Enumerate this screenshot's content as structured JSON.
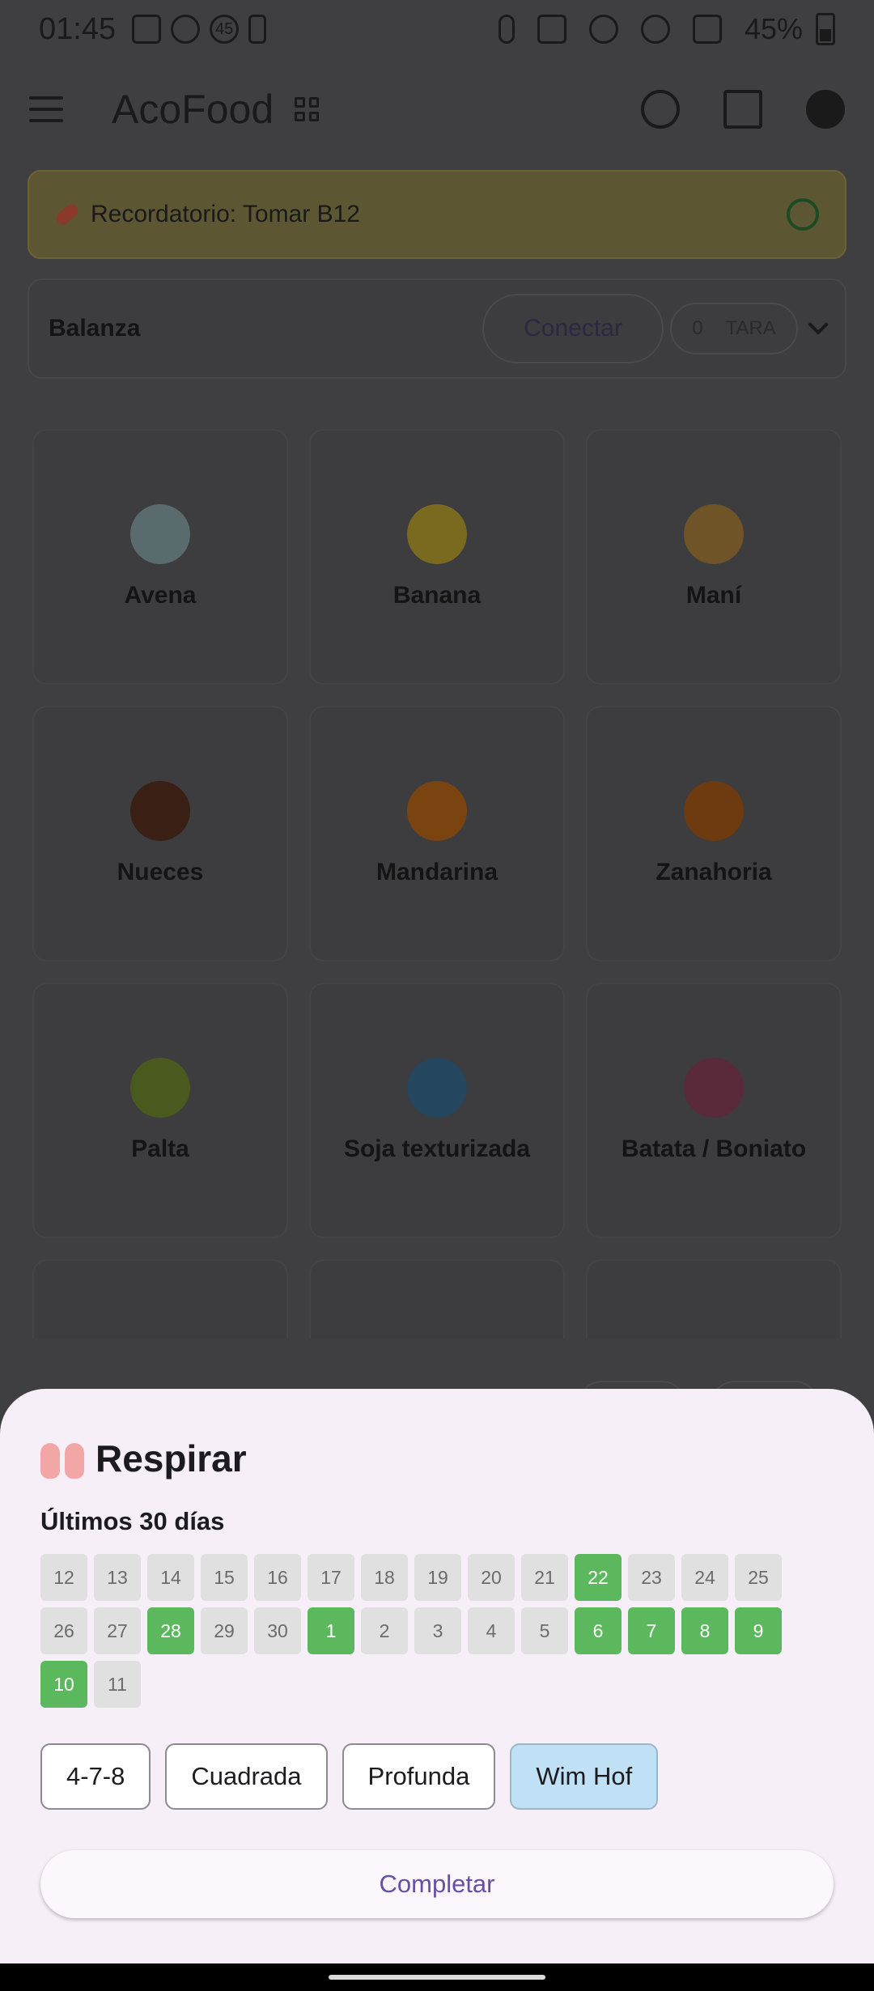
{
  "status_bar": {
    "time": "01:45",
    "badge": "45",
    "battery": "45%"
  },
  "app_bar": {
    "title": "AcoFood"
  },
  "reminder": {
    "text": "Recordatorio: Tomar B12"
  },
  "scale": {
    "label": "Balanza",
    "connect_label": "Conectar",
    "value": "0",
    "tara_label": "TARA"
  },
  "foods": [
    {
      "name": "Avena",
      "icon": "rice-bowl-icon",
      "color": "#5a6b6e"
    },
    {
      "name": "Banana",
      "icon": "banana-icon",
      "color": "#7a6a1f"
    },
    {
      "name": "Maní",
      "icon": "peanut-icon",
      "color": "#6e5426"
    },
    {
      "name": "Nueces",
      "icon": "chestnut-icon",
      "color": "#3a1f14"
    },
    {
      "name": "Mandarina",
      "icon": "tangerine-icon",
      "color": "#7a4410"
    },
    {
      "name": "Zanahoria",
      "icon": "carrot-icon",
      "color": "#6e3a10"
    },
    {
      "name": "Palta",
      "icon": "avocado-icon",
      "color": "#4a5a1e"
    },
    {
      "name": "Soja texturizada",
      "icon": "bowl-icon",
      "color": "#24465e"
    },
    {
      "name": "Batata / Boniato",
      "icon": "sweet-potato-icon",
      "color": "#5a2a3a"
    }
  ],
  "sheet": {
    "title": "Respirar",
    "subtitle": "Últimos 30 días",
    "days": [
      {
        "label": "12",
        "done": false
      },
      {
        "label": "13",
        "done": false
      },
      {
        "label": "14",
        "done": false
      },
      {
        "label": "15",
        "done": false
      },
      {
        "label": "16",
        "done": false
      },
      {
        "label": "17",
        "done": false
      },
      {
        "label": "18",
        "done": false
      },
      {
        "label": "19",
        "done": false
      },
      {
        "label": "20",
        "done": false
      },
      {
        "label": "21",
        "done": false
      },
      {
        "label": "22",
        "done": true
      },
      {
        "label": "23",
        "done": false
      },
      {
        "label": "24",
        "done": false
      },
      {
        "label": "25",
        "done": false
      },
      {
        "label": "26",
        "done": false
      },
      {
        "label": "27",
        "done": false
      },
      {
        "label": "28",
        "done": true
      },
      {
        "label": "29",
        "done": false
      },
      {
        "label": "30",
        "done": false
      },
      {
        "label": "1",
        "done": true
      },
      {
        "label": "2",
        "done": false
      },
      {
        "label": "3",
        "done": false
      },
      {
        "label": "4",
        "done": false
      },
      {
        "label": "5",
        "done": false
      },
      {
        "label": "6",
        "done": true
      },
      {
        "label": "7",
        "done": true
      },
      {
        "label": "8",
        "done": true
      },
      {
        "label": "9",
        "done": true
      },
      {
        "label": "10",
        "done": true
      },
      {
        "label": "11",
        "done": false
      }
    ],
    "techniques": [
      {
        "label": "4-7-8",
        "selected": false
      },
      {
        "label": "Cuadrada",
        "selected": false
      },
      {
        "label": "Profunda",
        "selected": false
      },
      {
        "label": "Wim Hof",
        "selected": true
      }
    ],
    "complete_label": "Completar"
  },
  "colors": {
    "done": "#5cb85c",
    "selected_chip": "#bfe0f5",
    "accent": "#6750a4"
  }
}
